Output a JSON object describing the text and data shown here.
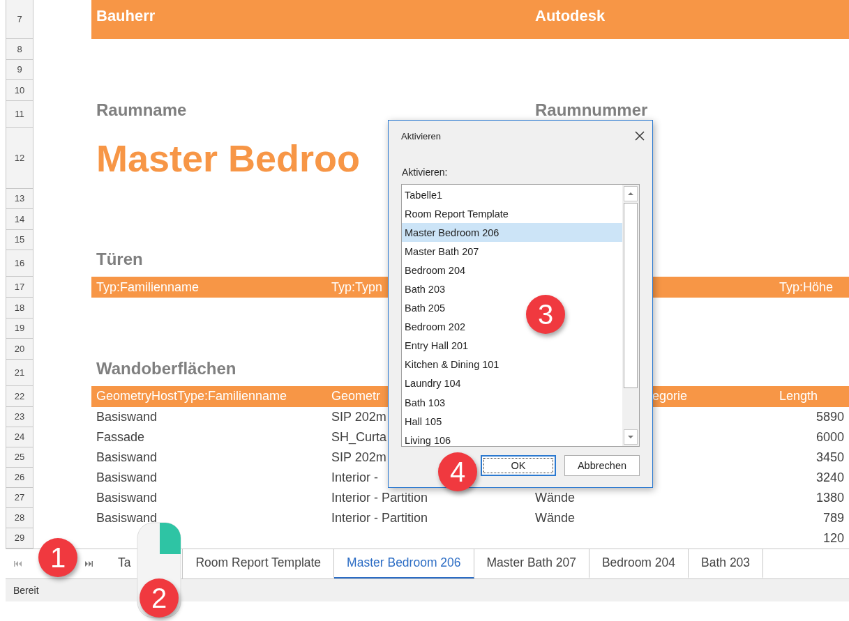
{
  "sheet": {
    "rows": [
      {
        "number": "7",
        "kind": "band",
        "cells": {
          "a": "Bauherr",
          "c": "Autodesk"
        }
      },
      {
        "number": "8",
        "kind": "blank"
      },
      {
        "number": "9",
        "kind": "blank"
      },
      {
        "number": "10",
        "kind": "blank"
      },
      {
        "number": "11",
        "kind": "label",
        "cells": {
          "a": "Raumname",
          "c": "Raumnummer"
        }
      },
      {
        "number": "12",
        "kind": "title",
        "cells": {
          "a": "Master Bedroo"
        }
      },
      {
        "number": "13",
        "kind": "blank"
      },
      {
        "number": "14",
        "kind": "blank"
      },
      {
        "number": "15",
        "kind": "blank"
      },
      {
        "number": "16",
        "kind": "label",
        "cells": {
          "a": "Türen"
        }
      },
      {
        "number": "17",
        "kind": "header",
        "cells": {
          "a": "Typ:Familienname",
          "b": "Typ:Typn",
          "d": "Typ:Höhe"
        }
      },
      {
        "number": "18",
        "kind": "blank"
      },
      {
        "number": "19",
        "kind": "blank"
      },
      {
        "number": "20",
        "kind": "blank"
      },
      {
        "number": "21",
        "kind": "label",
        "cells": {
          "a": "Wandoberflächen"
        }
      },
      {
        "number": "22",
        "kind": "header",
        "cells": {
          "a": "GeometryHostType:Familienname",
          "b": "Geometr",
          "c": "egorie",
          "d": "Length"
        }
      },
      {
        "number": "23",
        "kind": "data",
        "cells": {
          "a": "Basiswand",
          "b": "SIP 202m",
          "d": "5890"
        }
      },
      {
        "number": "24",
        "kind": "data",
        "cells": {
          "a": "Fassade",
          "b": "SH_Curta",
          "d": "6000"
        }
      },
      {
        "number": "25",
        "kind": "data",
        "cells": {
          "a": "Basiswand",
          "b": "SIP 202m",
          "d": "3450"
        }
      },
      {
        "number": "26",
        "kind": "data",
        "cells": {
          "a": "Basiswand",
          "b": "Interior -",
          "d": "3240"
        }
      },
      {
        "number": "27",
        "kind": "data",
        "cells": {
          "a": "Basiswand",
          "b": "Interior - Partition",
          "c": "Wände",
          "d": "1380"
        }
      },
      {
        "number": "28",
        "kind": "data",
        "cells": {
          "a": "Basiswand",
          "b": "Interior - Partition",
          "c": "Wände",
          "d": "789"
        }
      },
      {
        "number": "29",
        "kind": "data",
        "cells": {
          "d": "120"
        }
      }
    ]
  },
  "sheet_tabs": [
    {
      "label": "Ta",
      "selected": false
    },
    {
      "label": "Room Report Template",
      "selected": false
    },
    {
      "label": "Master Bedroom 206",
      "selected": true
    },
    {
      "label": "Master Bath 207",
      "selected": false
    },
    {
      "label": "Bedroom 204",
      "selected": false
    },
    {
      "label": "Bath 203",
      "selected": false
    }
  ],
  "status_bar": {
    "text": "Bereit"
  },
  "dialog": {
    "title": "Aktivieren",
    "label": "Aktivieren:",
    "items": [
      {
        "label": "Tabelle1",
        "selected": false
      },
      {
        "label": "Room Report Template",
        "selected": false
      },
      {
        "label": "Master Bedroom 206",
        "selected": true
      },
      {
        "label": "Master Bath 207",
        "selected": false
      },
      {
        "label": "Bedroom 204",
        "selected": false
      },
      {
        "label": "Bath 203",
        "selected": false
      },
      {
        "label": "Bath 205",
        "selected": false
      },
      {
        "label": "Bedroom 202",
        "selected": false
      },
      {
        "label": "Entry Hall 201",
        "selected": false
      },
      {
        "label": "Kitchen & Dining 101",
        "selected": false
      },
      {
        "label": "Laundry 104",
        "selected": false
      },
      {
        "label": "Bath 103",
        "selected": false
      },
      {
        "label": "Hall 105",
        "selected": false
      },
      {
        "label": "Living 106",
        "selected": false
      }
    ],
    "buttons": [
      {
        "label": "OK",
        "default": true
      },
      {
        "label": "Abbrechen",
        "default": false
      }
    ]
  },
  "callouts": [
    {
      "number": "1"
    },
    {
      "number": "2"
    },
    {
      "number": "3"
    },
    {
      "number": "4"
    }
  ]
}
